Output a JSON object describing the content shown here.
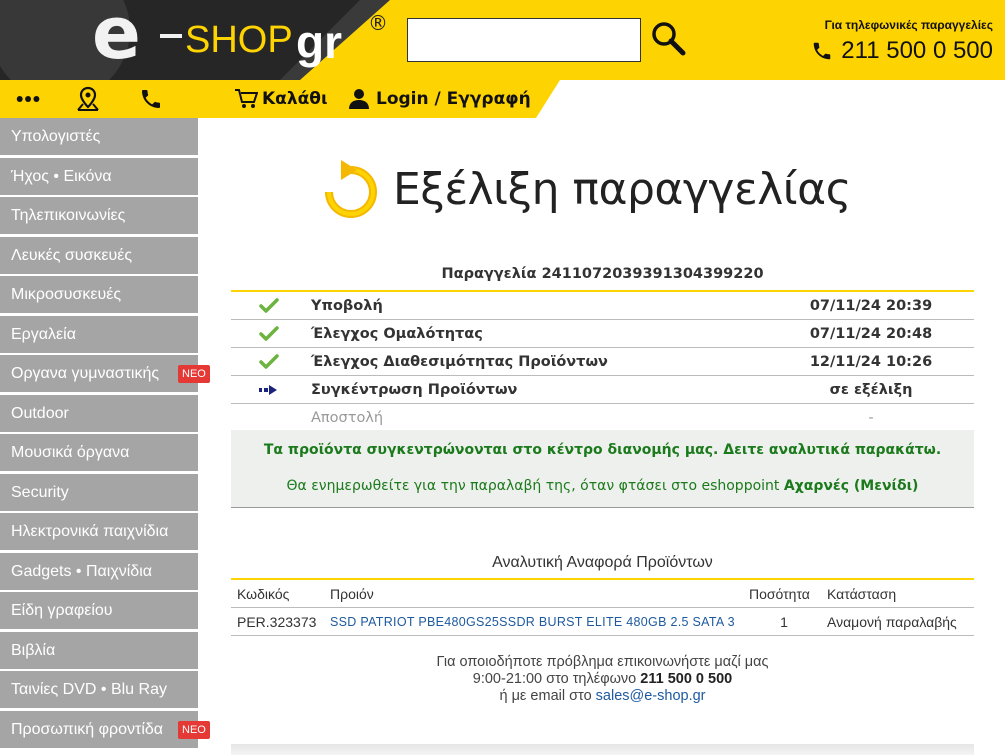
{
  "header": {
    "logo_e": "e",
    "logo_shop": "SHOP",
    "logo_gr": "gr",
    "logo_reg": "®",
    "search_placeholder": "",
    "phone_label": "Για τηλεφωνικές παραγγελίες",
    "phone_number": "211 500 0 500"
  },
  "nav": {
    "cart_label": "Καλάθι",
    "login_label": "Login / Εγγραφή"
  },
  "sidebar": {
    "items": [
      {
        "label": "Υπολογιστές",
        "badge": ""
      },
      {
        "label": "Ήχος • Εικόνα",
        "badge": ""
      },
      {
        "label": "Τηλεπικοινωνίες",
        "badge": ""
      },
      {
        "label": "Λευκές συσκευές",
        "badge": ""
      },
      {
        "label": "Μικροσυσκευές",
        "badge": ""
      },
      {
        "label": "Εργαλεία",
        "badge": ""
      },
      {
        "label": "Οργανα γυμναστικής",
        "badge": "NEO"
      },
      {
        "label": "Outdoor",
        "badge": ""
      },
      {
        "label": "Μουσικά όργανα",
        "badge": ""
      },
      {
        "label": "Security",
        "badge": ""
      },
      {
        "label": "Ηλεκτρονικά παιχνίδια",
        "badge": ""
      },
      {
        "label": "Gadgets • Παιχνίδια",
        "badge": ""
      },
      {
        "label": "Είδη γραφείου",
        "badge": ""
      },
      {
        "label": "Βιβλία",
        "badge": ""
      },
      {
        "label": "Ταινίες DVD • Blu Ray",
        "badge": ""
      },
      {
        "label": "Προσωπική φροντίδα",
        "badge": "NEO"
      }
    ]
  },
  "main": {
    "title": "Εξέλιξη παραγγελίας",
    "order_label": "Παραγγελία 241107203939130439922​0",
    "statuses": [
      {
        "icon": "check-icon",
        "label": "Υποβολή",
        "date": "07/11/24 20:39",
        "state": "done"
      },
      {
        "icon": "check-icon",
        "label": "Έλεγχος Ομαλότητας",
        "date": "07/11/24 20:48",
        "state": "done"
      },
      {
        "icon": "check-icon",
        "label": "Έλεγχος Διαθεσιμότητας Προϊόντων",
        "date": "12/11/24 10:26",
        "state": "done"
      },
      {
        "icon": "arrow-right-icon",
        "label": "Συγκέντρωση Προϊόντων",
        "date": "σε εξέλιξη",
        "state": "current"
      },
      {
        "icon": "",
        "label": "Αποστολή",
        "date": "-",
        "state": "pending"
      }
    ],
    "info_line1": "Τα προϊόντα συγκεντρώνονται στο κέντρο διανομής μας. Δειτε αναλυτικά παρακάτω.",
    "info_line2_prefix": "Θα ενημερωθείτε για την παραλαβή της, όταν φτάσει στο eshoppoint",
    "info_line2_location": "Αχαρνές (Μενίδι)",
    "report_title": "Αναλυτική Αναφορά Προϊόντων",
    "table": {
      "headers": [
        "Κωδικός",
        "Προιόν",
        "Ποσότητα",
        "Κατάσταση"
      ],
      "rows": [
        {
          "code": "PER.323373",
          "product": "SSD PATRIOT PBE480GS25SSDR BURST ELITE 480GB 2.5 SATA 3",
          "qty": "1",
          "status": "Αναμονή παραλαβής"
        }
      ]
    },
    "contact_line1": "Για οποιοδήποτε πρόβλημα επικοινωνήστε μαζί μας",
    "contact_line2_prefix": "9:00-21:00 στο τηλέφωνο",
    "contact_phone": "211 500 0 500",
    "contact_line3_prefix": "ή με email στο",
    "contact_email": "sales@e-shop.gr"
  },
  "colors": {
    "brand_yellow": "#fed302",
    "sidebar_gray": "#a5a5a5",
    "badge_red": "#e53935",
    "success_green": "#1b7a1b",
    "link_blue": "#1e5aa0"
  }
}
